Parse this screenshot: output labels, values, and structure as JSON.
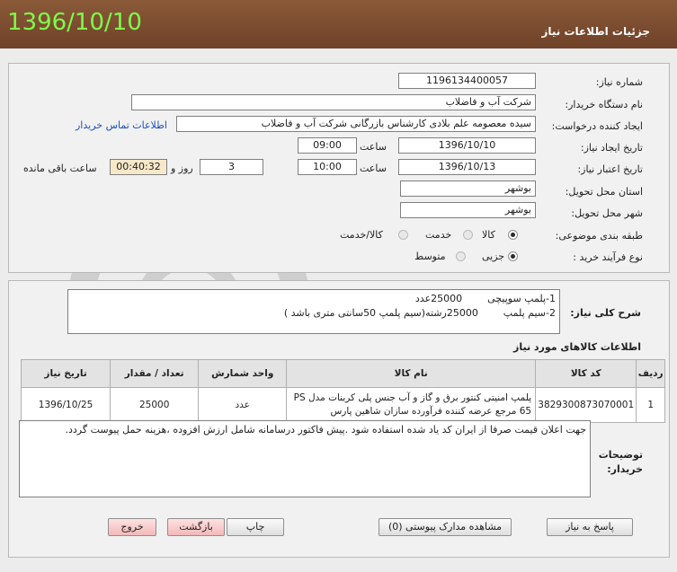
{
  "header": {
    "title": "جزئیات اطلاعات نیاز",
    "date": "1396/10/10"
  },
  "form": {
    "need_number_label": "شماره نیاز:",
    "need_number": "1196134400057",
    "buyer_org_label": "نام دستگاه خریدار:",
    "buyer_org": "شرکت آب و فاضلاب",
    "requester_label": "ایجاد کننده درخواست:",
    "requester": "سیده معصومه علم بلادی کارشناس بازرگانی شرکت آب و فاضلاب",
    "contact_link": "اطلاعات تماس خریدار",
    "created_label": "تاریخ ایجاد نیاز:",
    "created_date": "1396/10/10",
    "time_label": "ساعت",
    "created_time": "09:00",
    "valid_label": "تاریخ اعتبار نیاز:",
    "valid_date": "1396/10/13",
    "valid_time": "10:00",
    "days": "3",
    "days_label": "روز و",
    "remaining_time": "00:40:32",
    "remaining_label": "ساعت باقی مانده",
    "province_label": "استان محل تحویل:",
    "province": "بوشهر",
    "city_label": "شهر محل تحویل:",
    "city": "بوشهر",
    "category_label": "طبقه بندی موضوعی:",
    "cat_goods": "کالا",
    "cat_service": "خدمت",
    "cat_both": "کالا/خدمت",
    "purchase_label": "نوع فرآیند خرید :",
    "proc_partial": "جزیی",
    "proc_medium": "متوسط"
  },
  "summary": {
    "label": "شرح کلی نیاز:",
    "line1": "1-پلمپ سوپیچی        25000عدد",
    "line2": "2-سیم پلمپ        25000رشته(سیم پلمپ 50سانتی متری باشد )"
  },
  "goods": {
    "title": "اطلاعات کالاهای مورد نیاز",
    "columns": [
      "ردیف",
      "کد کالا",
      "نام کالا",
      "واحد شمارش",
      "تعداد / مقدار",
      "تاریخ نیاز"
    ],
    "rows": [
      {
        "row": "1",
        "code": "3829300873070001",
        "name": "پلمپ امنیتی کنتور برق و گاز و آب جنس پلی کربنات مدل PS 65 مرجع عرضه کننده فرآورده سازان شاهین پارس",
        "unit": "عدد",
        "qty": "25000",
        "date": "1396/10/25"
      }
    ]
  },
  "notes": {
    "label": "توضیحات خریدار:",
    "text": "جهت اعلان قیمت صرفا از ایران کد یاد شده استفاده شود .پیش فاکتور درسامانه شامل ارزش افزوده ،هزینه حمل پیوست گردد."
  },
  "buttons": {
    "reply": "پاسخ به نیاز",
    "attachments": "مشاهده مدارک پیوستی (0)",
    "print": "چاپ",
    "back": "بازگشت",
    "exit": "خروج"
  }
}
